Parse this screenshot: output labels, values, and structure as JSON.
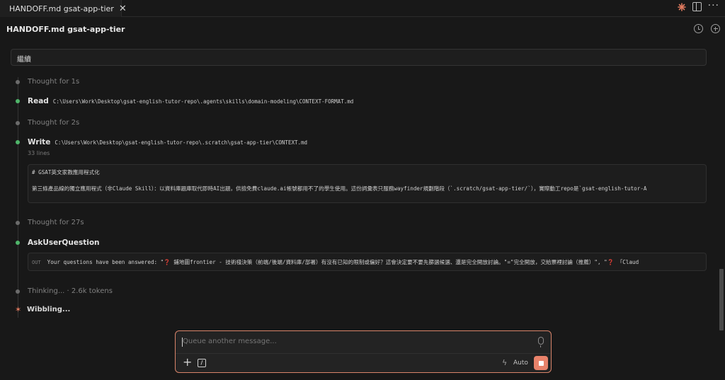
{
  "tab": {
    "title": "HANDOFF.md gsat-app-tier",
    "close_glyph": "✕",
    "icon": "claude-sparkle-icon"
  },
  "header": {
    "title": "HANDOFF.md gsat-app-tier"
  },
  "user_message": "繼續",
  "steps": {
    "thought1": "Thought for 1s",
    "read_label": "Read",
    "read_path": "C:\\Users\\Work\\Desktop\\gsat-english-tutor-repo\\.agents\\skills\\domain-modeling\\CONTEXT-FORMAT.md",
    "thought2": "Thought for 2s",
    "write_label": "Write",
    "write_path": "C:\\Users\\Work\\Desktop\\gsat-english-tutor-repo\\.scratch\\gsat-app-tier\\CONTEXT.md",
    "write_lines": "33 lines",
    "write_line1": "# GSAT英文家教應用程式化",
    "write_line2": "第三條產品線的獨立應用程式（非Claude Skill）：以資料庫題庫取代即時AI出題，供撿免費claude.ai帳號都用不了的學生使用。這份詞彙表只服務wayfinder規劃階段（`.scratch/gsat-app-tier/`），實際動工repo是`gsat-english-tutor-A",
    "thought3": "Thought for 27s",
    "ask_label": "AskUserQuestion",
    "out_tag": "OUT",
    "ask_output_a": "Your questions have been answered: \"",
    "ask_q": "❓",
    "ask_output_b": " 鋪地圖frontier - 技術棧決策（前端/後端/資料庫/部署）有沒有已知的限制或偏好？這會決定要不要先篩選候選、還是完全開放討論。\"=\"完全開放，交給票裡討論（推薦）\", \"",
    "ask_output_c": " 「Claud",
    "thinking": "Thinking... · 2.6k tokens",
    "wibbling_glyph": "✶",
    "wibbling": "Wibbling..."
  },
  "composer": {
    "placeholder": "Queue another message...",
    "plus_glyph": "+",
    "slash_glyph": "/",
    "bolt_glyph": "ϟ",
    "mode_label": "Auto"
  },
  "colors": {
    "accent": "#e8826a",
    "success": "#4fb56a",
    "bg": "#181818"
  }
}
